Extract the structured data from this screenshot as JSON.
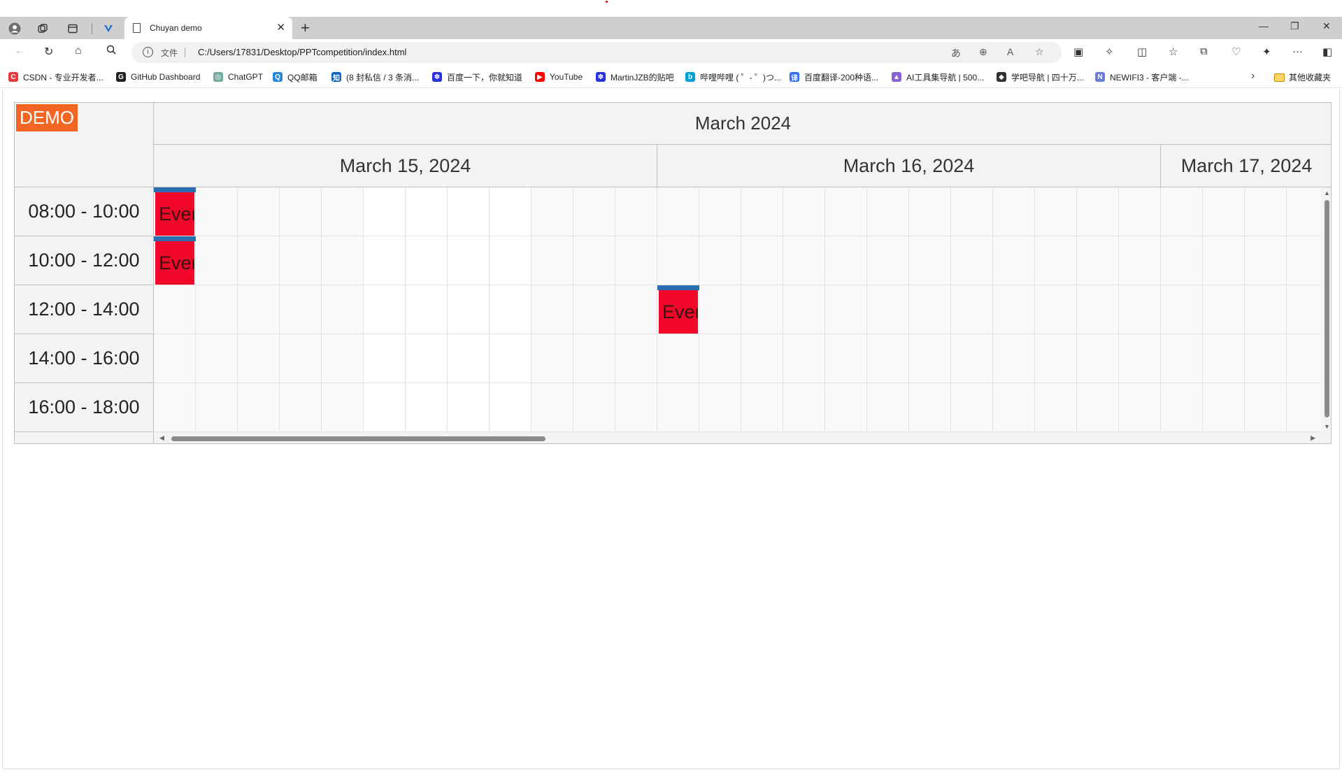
{
  "browser": {
    "tab_title": "Chuyan demo",
    "address_label": "文件",
    "url": "C:/Users/17831/Desktop/PPTcompetition/index.html",
    "bookmarks": [
      {
        "label": "CSDN - 专业开发者...",
        "color": "#e4393c",
        "icon": "C"
      },
      {
        "label": "GitHub Dashboard",
        "color": "#222222",
        "icon": "G"
      },
      {
        "label": "ChatGPT",
        "color": "#74aa9c",
        "icon": "◎"
      },
      {
        "label": "QQ邮箱",
        "color": "#2a86d6",
        "icon": "Q"
      },
      {
        "label": "(8 封私信 / 3 条消...",
        "color": "#0a66c2",
        "icon": "知"
      },
      {
        "label": "百度一下，你就知道",
        "color": "#2932e1",
        "icon": "✽"
      },
      {
        "label": "YouTube",
        "color": "#ff0000",
        "icon": "▶"
      },
      {
        "label": "MartinJZB的贴吧",
        "color": "#2932e1",
        "icon": "✽"
      },
      {
        "label": "哔哩哔哩 ( ゜- ゜)つ...",
        "color": "#00a1d6",
        "icon": "b"
      },
      {
        "label": "百度翻译-200种语...",
        "color": "#2d6df6",
        "icon": "译"
      },
      {
        "label": "AI工具集导航 | 500...",
        "color": "#8a63d2",
        "icon": "▲"
      },
      {
        "label": "学吧导航 | 四十万...",
        "color": "#333333",
        "icon": "◆"
      },
      {
        "label": "NEWIFI3 - 客户端 -...",
        "color": "#6b7bd6",
        "icon": "N"
      }
    ],
    "other_bookmarks": "其他收藏夹"
  },
  "scheduler": {
    "badge": "DEMO",
    "month": "March 2024",
    "days": [
      "March 15, 2024",
      "March 16, 2024",
      "March 17, 2024"
    ],
    "time_slots": [
      "08:00 - 10:00",
      "10:00 - 12:00",
      "12:00 - 14:00",
      "14:00 - 16:00",
      "16:00 - 18:00"
    ],
    "events": [
      {
        "text": "Ever",
        "day": "March 15, 2024",
        "slot": "08:00 - 10:00",
        "column": 0
      },
      {
        "text": "Ever",
        "day": "March 15, 2024",
        "slot": "10:00 - 12:00",
        "column": 0
      },
      {
        "text": "Ever",
        "day": "March 16, 2024",
        "slot": "12:00 - 14:00",
        "column": 12
      }
    ],
    "event_color": "#f0072a",
    "event_bar_color": "#2a6db0",
    "badge_color": "#f26522"
  }
}
